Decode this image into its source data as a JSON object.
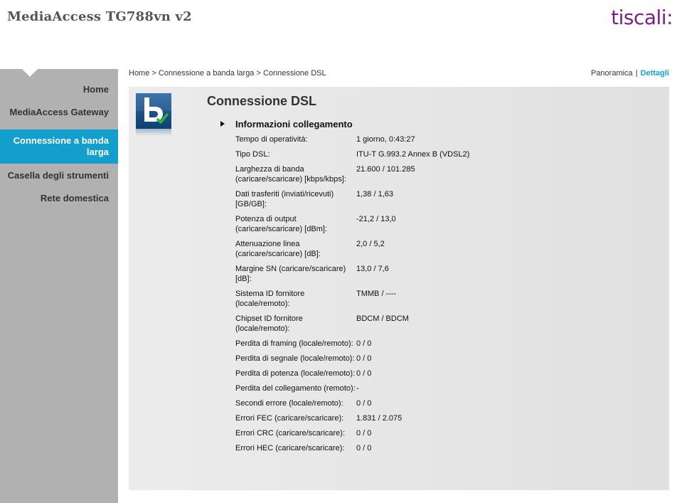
{
  "header": {
    "device_title": "MediaAccess TG788vn v2",
    "brand": "tiscali:"
  },
  "sidebar": {
    "items": [
      {
        "label": "Home"
      },
      {
        "label": "MediaAccess Gateway"
      },
      {
        "label": "Connessione a banda larga",
        "active": true
      },
      {
        "label": "Casella degli strumenti"
      },
      {
        "label": "Rete domestica"
      }
    ]
  },
  "breadcrumb": "Home > Connessione a banda larga > Connessione DSL",
  "view_links": {
    "overview": "Panoramica",
    "separator": "|",
    "details": "Dettagli"
  },
  "page": {
    "title": "Connessione DSL",
    "section_title": "Informazioni collegamento",
    "icon": "broadband-check-icon",
    "rows": [
      {
        "label": "Tempo di operatività:",
        "value": "1 giorno, 0:43:27"
      },
      {
        "label": "Tipo DSL:",
        "value": "ITU-T G.993.2 Annex B (VDSL2)"
      },
      {
        "label": "Larghezza di banda (caricare/scaricare) [kbps/kbps]:",
        "value": "21.600 / 101.285"
      },
      {
        "label": "Dati trasferiti (inviati/ricevuti) [GB/GB]:",
        "value": "1,38 / 1,63"
      },
      {
        "label": "Potenza di output (caricare/scaricare) [dBm]:",
        "value": "-21,2 / 13,0"
      },
      {
        "label": "Attenuazione linea (caricare/scaricare) [dB]:",
        "value": "2,0 / 5,2"
      },
      {
        "label": "Margine SN (caricare/scaricare) [dB]:",
        "value": "13,0 / 7,6"
      },
      {
        "label": "Sistema ID fornitore (locale/remoto):",
        "value": "TMMB / ----"
      },
      {
        "label": "Chipset ID fornitore (locale/remoto):",
        "value": "BDCM / BDCM"
      },
      {
        "label": "Perdita di framing (locale/remoto):",
        "value": "0 / 0"
      },
      {
        "label": "Perdita di segnale (locale/remoto):",
        "value": "0 / 0"
      },
      {
        "label": "Perdita di potenza (locale/remoto):",
        "value": "0 / 0"
      },
      {
        "label": "Perdita del collegamento (remoto):",
        "value": "-"
      },
      {
        "label": "Secondi errore (locale/remoto):",
        "value": "0 / 0"
      },
      {
        "label": "Errori FEC (caricare/scaricare):",
        "value": "1.831 / 2.075"
      },
      {
        "label": "Errori CRC (caricare/scaricare):",
        "value": "0 / 0"
      },
      {
        "label": "Errori HEC (caricare/scaricare):",
        "value": "0 / 0"
      }
    ]
  },
  "colors": {
    "accent": "#139fcd",
    "brand": "#7a1f8a",
    "sidebar": "#b1b1b1"
  }
}
